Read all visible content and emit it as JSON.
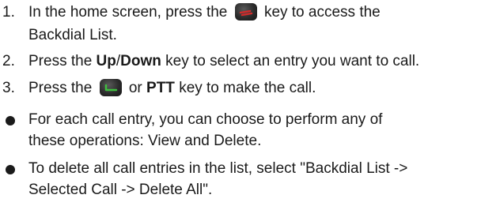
{
  "steps": [
    {
      "number": "1.",
      "line1_before": "In the home screen, press the",
      "line1_after": "key to access the",
      "line2": "Backdial List.",
      "icon": "end-key-icon"
    },
    {
      "number": "2.",
      "before": "Press the",
      "bold1": "Up",
      "slash": "/",
      "bold2": "Down",
      "after": "key to select an entry you want to call."
    },
    {
      "number": "3.",
      "before": "Press the",
      "or_text": "or",
      "bold": "PTT",
      "after": "key to make the call.",
      "icon": "send-key-icon"
    }
  ],
  "notes": [
    {
      "line1": "For each call entry, you can choose to perform any of",
      "line2": "these operations: View and Delete."
    },
    {
      "line1": "To delete all call entries in the list, select \"Backdial List ->",
      "line2": "Selected Call -> Delete All\"."
    }
  ],
  "colors": {
    "text": "#1a1a1a",
    "end_key_accent": "#d42a2a",
    "send_key_accent": "#3fbf3f"
  }
}
